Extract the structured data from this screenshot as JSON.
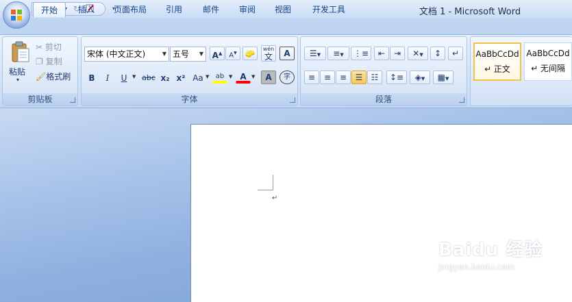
{
  "window": {
    "title": "文档 1 - Microsoft Word"
  },
  "quick_access": {
    "save_icon": "save-icon",
    "undo_icon": "undo-icon",
    "redo_icon": "redo-icon",
    "customize_icon": "customize-icon",
    "arrow": "▾"
  },
  "tabs": [
    {
      "label": "开始",
      "active": true
    },
    {
      "label": "插入"
    },
    {
      "label": "页面布局"
    },
    {
      "label": "引用"
    },
    {
      "label": "邮件"
    },
    {
      "label": "审阅"
    },
    {
      "label": "视图"
    },
    {
      "label": "开发工具"
    }
  ],
  "clipboard": {
    "group_label": "剪贴板",
    "paste": "粘贴",
    "cut": "剪切",
    "copy": "复制",
    "format_painter": "格式刷"
  },
  "font": {
    "group_label": "字体",
    "font_name": "宋体 (中文正文)",
    "font_size": "五号",
    "grow": "A",
    "shrink": "A",
    "phonetic": "wén",
    "phonetic_char": "文",
    "border_char": "A",
    "bold": "B",
    "italic": "I",
    "underline": "U",
    "strike": "abc",
    "subscript": "x₂",
    "superscript": "x²",
    "change_case": "Aa",
    "highlight": "ab",
    "font_color": "A",
    "shading": "A",
    "enclose": "字"
  },
  "paragraph": {
    "group_label": "段落"
  },
  "styles": {
    "items": [
      {
        "sample": "AaBbCcDd",
        "name": "↵ 正文",
        "selected": true
      },
      {
        "sample": "AaBbCcDd",
        "name": "↵ 无间隔"
      }
    ]
  },
  "document": {
    "paragraph_mark": "↵"
  },
  "watermark": {
    "brand": "Baidu 经验",
    "url": "jingyan.baidu.com"
  },
  "colors": {
    "accent": "#15428b",
    "highlight": "#ffff00",
    "font_red": "#ff0000",
    "selected_gold": "#f3c04c"
  }
}
